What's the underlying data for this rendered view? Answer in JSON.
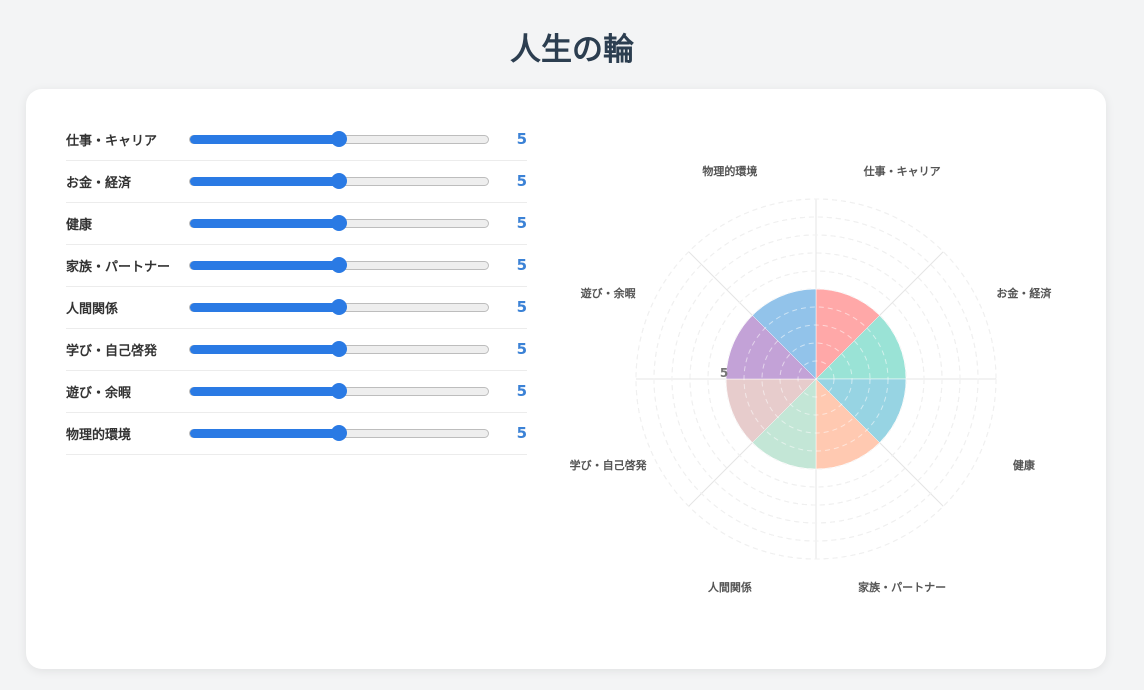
{
  "title": "人生の輪",
  "max_value": 10,
  "categories": [
    {
      "label": "仕事・キャリア",
      "value": 5,
      "color": "#ff9f9f"
    },
    {
      "label": "お金・経済",
      "value": 5,
      "color": "#8fe0d2"
    },
    {
      "label": "健康",
      "value": 5,
      "color": "#8ccfe0"
    },
    {
      "label": "家族・パートナー",
      "value": 5,
      "color": "#ffc3a8"
    },
    {
      "label": "人間関係",
      "value": 5,
      "color": "#bde3d2"
    },
    {
      "label": "学び・自己啓発",
      "value": 5,
      "color": "#e4c7c7"
    },
    {
      "label": "遊び・余暇",
      "value": 5,
      "color": "#bd98d3"
    },
    {
      "label": "物理的環境",
      "value": 5,
      "color": "#86bde8"
    }
  ],
  "wheel": {
    "scale_label": "5"
  }
}
